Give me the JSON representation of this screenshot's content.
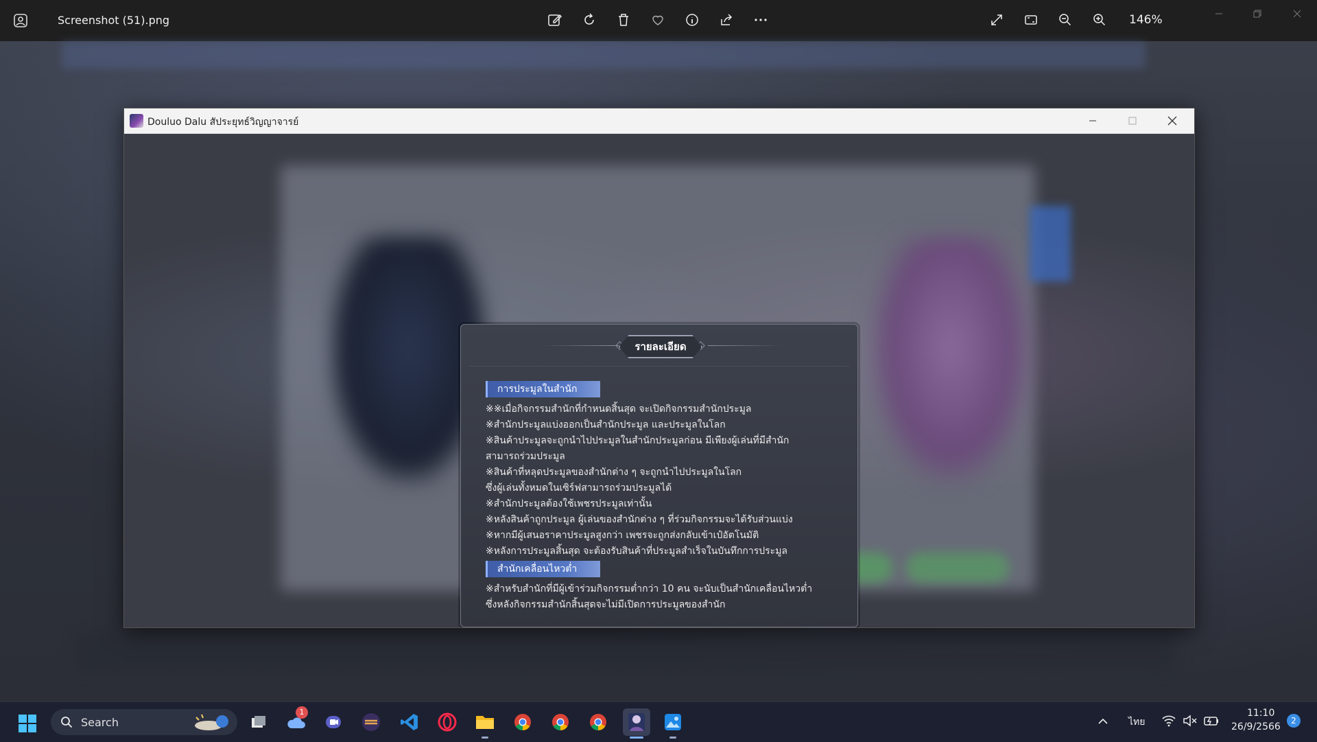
{
  "viewer": {
    "filename": "Screenshot (51).png",
    "zoom": "146%",
    "tools": [
      "edit-icon",
      "rotate-icon",
      "delete-icon",
      "favorite-icon",
      "info-icon",
      "share-icon",
      "more-icon"
    ],
    "right_tools": [
      "fullscreen-icon",
      "fit-icon",
      "zoom-out-icon",
      "zoom-in-icon"
    ]
  },
  "game_window": {
    "title": "Douluo Dalu  สัประยุทธ์วิญญาจารย์"
  },
  "dialog": {
    "title": "รายละเอียด",
    "sections": [
      {
        "heading": "การประมูลในสำนัก",
        "lines": [
          "※※เมื่อกิจกรรมสำนักที่กำหนดสิ้นสุด จะเปิดกิจกรรมสำนักประมูล",
          "※สำนักประมูลแบ่งออกเป็นสำนักประมูล และประมูลในโลก",
          "※สินค้าประมูลจะถูกนำไปประมูลในสำนักประมูลก่อน มีเพียงผู้เล่นที่มีสำนัก",
          "สามารถร่วมประมูล",
          "※สินค้าที่หลุดประมูลของสำนักต่าง ๆ จะถูกนำไปประมูลในโลก",
          "ซึ่งผู้เล่นทั้งหมดในเซิร์ฟสามารถร่วมประมูลได้",
          "※สำนักประมูลต้องใช้เพชรประมูลเท่านั้น",
          "※หลังสินค้าถูกประมูล ผู้เล่นของสำนักต่าง ๆ ที่ร่วมกิจกรรมจะได้รับส่วนแบ่ง",
          "※หากมีผู้เสนอราคาประมูลสูงกว่า เพชรจะถูกส่งกลับเข้าเป๋อัตโนมัติ",
          "※หลังการประมูลสิ้นสุด จะต้องรับสินค้าที่ประมูลสำเร็จในบันทึกการประมูล"
        ]
      },
      {
        "heading": "สำนักเคลื่อนไหวต่ำ",
        "lines": [
          "※สำหรับสำนักที่มีผู้เข้าร่วมกิจกรรมต่ำกว่า 10 คน จะนับเป็นสำนักเคลื่อนไหวต่ำ",
          "ซึ่งหลังกิจกรรมสำนักสิ้นสุดจะไม่มีเปิดการประมูลของสำนัก"
        ]
      }
    ]
  },
  "taskbar": {
    "search_label": "Search",
    "weather_badge": "1",
    "apps": [
      "file-explorer-blank-icon",
      "weather-icon",
      "teams-meet-icon",
      "app-icon",
      "vscode-icon",
      "opera-icon",
      "file-explorer-icon",
      "chrome-icon",
      "chrome-icon-2",
      "chrome-icon-3",
      "douluo-game-icon",
      "photos-icon"
    ],
    "language": "ไทย",
    "time": "11:10",
    "date": "26/9/2566",
    "notifications": "2"
  }
}
